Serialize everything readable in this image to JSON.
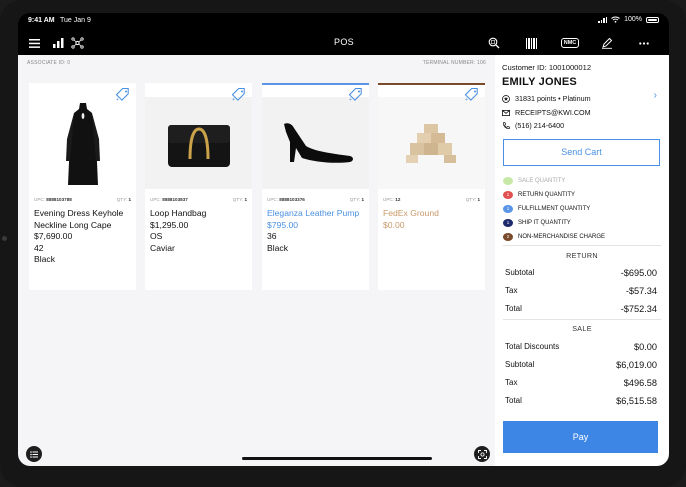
{
  "status": {
    "time": "9:41 AM",
    "date": "Tue Jan 9",
    "battery": "100%"
  },
  "topbar": {
    "title": "POS",
    "nmc_label": "NMC",
    "icons": [
      "menu-icon",
      "bar-chart-icon",
      "network-icon",
      "search-product-icon",
      "barcode-icon",
      "nmc-icon",
      "pen-icon",
      "more-icon"
    ]
  },
  "products": {
    "associate": "ASSOCIATE ID: 0",
    "terminal": "TERMINAL NUMBER: 106",
    "items": [
      {
        "upc_label": "UPC:",
        "upc": "8888103788",
        "qty_label": "QTY:",
        "qty": "1",
        "lines": [
          "Evening Dress Keyhole",
          "Neckline Long Cape",
          "$7,690.00",
          "42",
          "Black"
        ],
        "bar_color": "#ffffff"
      },
      {
        "upc_label": "UPC:",
        "upc": "8888103837",
        "qty_label": "QTY:",
        "qty": "1",
        "lines": [
          "Loop Handbag",
          "$1,295.00",
          "OS",
          "Caviar"
        ],
        "bar_color": "#ffffff"
      },
      {
        "upc_label": "UPC:",
        "upc": "8888103376",
        "qty_label": "QTY:",
        "qty": "1",
        "lines": [
          "Eleganza Leather Pump",
          "$795.00",
          "36",
          "Black"
        ],
        "bar_color": "#5a95e8"
      },
      {
        "upc_label": "UPC:",
        "upc": "12",
        "qty_label": "QTY:",
        "qty": "1",
        "lines": [
          "FedEx Ground",
          "$0.00"
        ],
        "bar_color": "#7a4b2a"
      }
    ]
  },
  "customer": {
    "id_line": "Customer ID: 1001000012",
    "name": "EMILY JONES",
    "points": "31831 points • Platinum",
    "email": "RECEIPTS@KWI.COM",
    "phone": "(516) 214-6400"
  },
  "send_cart_label": "Send Cart",
  "legend": [
    {
      "label": "SALE QUANTITY",
      "color": "#a6d96a",
      "muted": true,
      "num": ""
    },
    {
      "label": "RETURN QUANTITY",
      "color": "#e05252",
      "muted": false,
      "num": "1"
    },
    {
      "label": "FULFILLMENT QUANTITY",
      "color": "#5a95e8",
      "muted": false,
      "num": "1"
    },
    {
      "label": "SHIP IT QUANTITY",
      "color": "#1e2a6e",
      "muted": false,
      "num": "1"
    },
    {
      "label": "NON-MERCHANDISE CHARGE",
      "color": "#7a4b2a",
      "muted": false,
      "num": "2"
    }
  ],
  "return": {
    "title": "RETURN",
    "rows": [
      {
        "label": "Subtotal",
        "value": "-$695.00"
      },
      {
        "label": "Tax",
        "value": "-$57.34"
      },
      {
        "label": "Total",
        "value": "-$752.34"
      }
    ]
  },
  "sale": {
    "title": "SALE",
    "rows": [
      {
        "label": "Total Discounts",
        "value": "$0.00"
      },
      {
        "label": "Subtotal",
        "value": "$6,019.00"
      },
      {
        "label": "Tax",
        "value": "$496.58"
      },
      {
        "label": "Total",
        "value": "$6,515.58"
      }
    ]
  },
  "pay_label": "Pay",
  "colors": {
    "accent": "#3d86e6",
    "panel_bg": "#f5f4f7"
  }
}
